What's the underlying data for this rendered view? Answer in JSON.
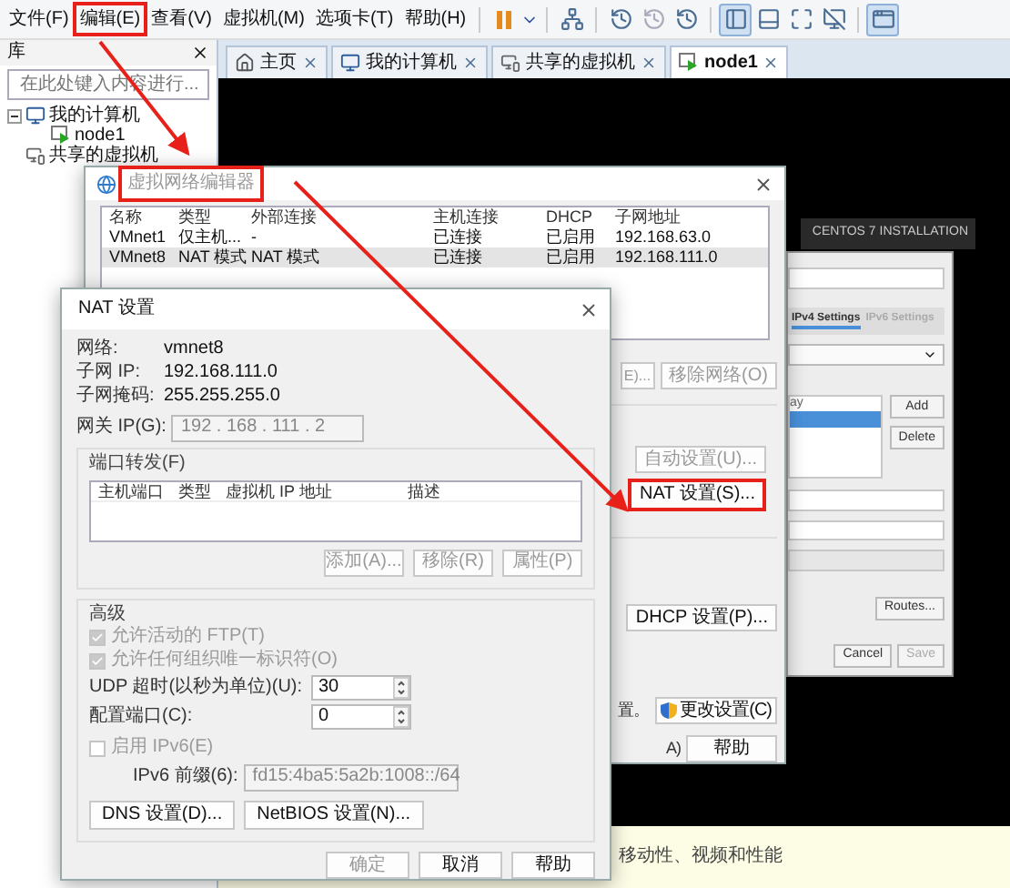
{
  "menu": [
    {
      "label": "文件(F)",
      "annotated": false
    },
    {
      "label": "编辑(E)",
      "annotated": true
    },
    {
      "label": "查看(V)",
      "annotated": false
    },
    {
      "label": "虚拟机(M)",
      "annotated": false
    },
    {
      "label": "选项卡(T)",
      "annotated": false
    },
    {
      "label": "帮助(H)",
      "annotated": false
    }
  ],
  "library": {
    "title": "库",
    "search_placeholder": "在此处键入内容进行...",
    "tree": [
      {
        "label": "我的计算机",
        "kind": "computer",
        "expanded": true,
        "children": [
          {
            "label": "node1",
            "kind": "vm"
          }
        ]
      },
      {
        "label": "共享的虚拟机",
        "kind": "shared"
      }
    ]
  },
  "tabs": [
    {
      "label": "主页",
      "kind": "home",
      "selected": false
    },
    {
      "label": "我的计算机",
      "kind": "computer",
      "selected": false
    },
    {
      "label": "共享的虚拟机",
      "kind": "shared",
      "selected": false
    },
    {
      "label": "node1",
      "kind": "vm",
      "selected": true
    }
  ],
  "installer": {
    "title": "CENTOS 7 INSTALLATION",
    "tabs": [
      {
        "label": "IPv4 Settings",
        "selected": true
      },
      {
        "label": "IPv6 Settings",
        "selected": false
      }
    ],
    "list_header": "ay",
    "buttons": [
      "Add",
      "Delete"
    ],
    "routes": "Routes...",
    "footer": [
      {
        "label": "Cancel",
        "disabled": false
      },
      {
        "label": "Save",
        "disabled": true
      }
    ]
  },
  "bottom_bar": {
    "text": "移动性、视频和性能"
  },
  "network_editor": {
    "title": "虚拟网络编辑器",
    "title_annotated": true,
    "columns": [
      "名称",
      "类型",
      "外部连接",
      "主机连接",
      "DHCP",
      "子网地址"
    ],
    "rows": [
      {
        "cells": [
          "VMnet1",
          "仅主机...",
          "-",
          "已连接",
          "已启用",
          "192.168.63.0"
        ],
        "selected": false
      },
      {
        "cells": [
          "VMnet8",
          "NAT 模式",
          "NAT 模式",
          "已连接",
          "已启用",
          "192.168.111.0"
        ],
        "selected": true
      }
    ],
    "rename_partial": "E)...",
    "remove": "移除网络(O)",
    "auto": {
      "label": "自动设置(U)...",
      "disabled": true
    },
    "nat": {
      "label": "NAT 设置(S)...",
      "annotated": true
    },
    "dhcp": "DHCP 设置(P)...",
    "notice_partial": "置。",
    "change": "更改设置(C)",
    "apply_partial": "A)",
    "help": "帮助"
  },
  "nat_dialog": {
    "title": "NAT 设置",
    "info": [
      {
        "label": "网络:",
        "value": "vmnet8"
      },
      {
        "label": "子网 IP:",
        "value": "192.168.111.0"
      },
      {
        "label": "子网掩码:",
        "value": "255.255.255.0"
      }
    ],
    "gateway_label": "网关 IP(G):",
    "gateway": "192 . 168 . 111 . 2",
    "port_forwarding": {
      "title": "端口转发(F)",
      "columns": [
        "主机端口",
        "类型",
        "虚拟机 IP 地址",
        "描述"
      ],
      "buttons": [
        {
          "label": "添加(A)...",
          "disabled": true
        },
        {
          "label": "移除(R)",
          "disabled": true
        },
        {
          "label": "属性(P)",
          "disabled": true
        }
      ]
    },
    "advanced": {
      "title": "高级",
      "checkboxes": [
        {
          "label": "允许活动的 FTP(T)",
          "checked": true,
          "disabled": true
        },
        {
          "label": "允许任何组织唯一标识符(O)",
          "checked": true,
          "disabled": true
        }
      ],
      "spinners": [
        {
          "label": "UDP 超时(以秒为单位)(U):",
          "value": "30"
        },
        {
          "label": "配置端口(C):",
          "value": "0"
        }
      ],
      "ipv6": {
        "label": "启用 IPv6(E)",
        "checked": false,
        "disabled": true
      },
      "prefix_label": "IPv6 前缀(6):",
      "prefix": "fd15:4ba5:5a2b:1008::/64",
      "buttons": [
        "DNS 设置(D)...",
        "NetBIOS 设置(N)..."
      ]
    },
    "footer": [
      {
        "label": "确定",
        "disabled": true
      },
      {
        "label": "取消",
        "disabled": false
      },
      {
        "label": "帮助",
        "disabled": false
      }
    ]
  }
}
